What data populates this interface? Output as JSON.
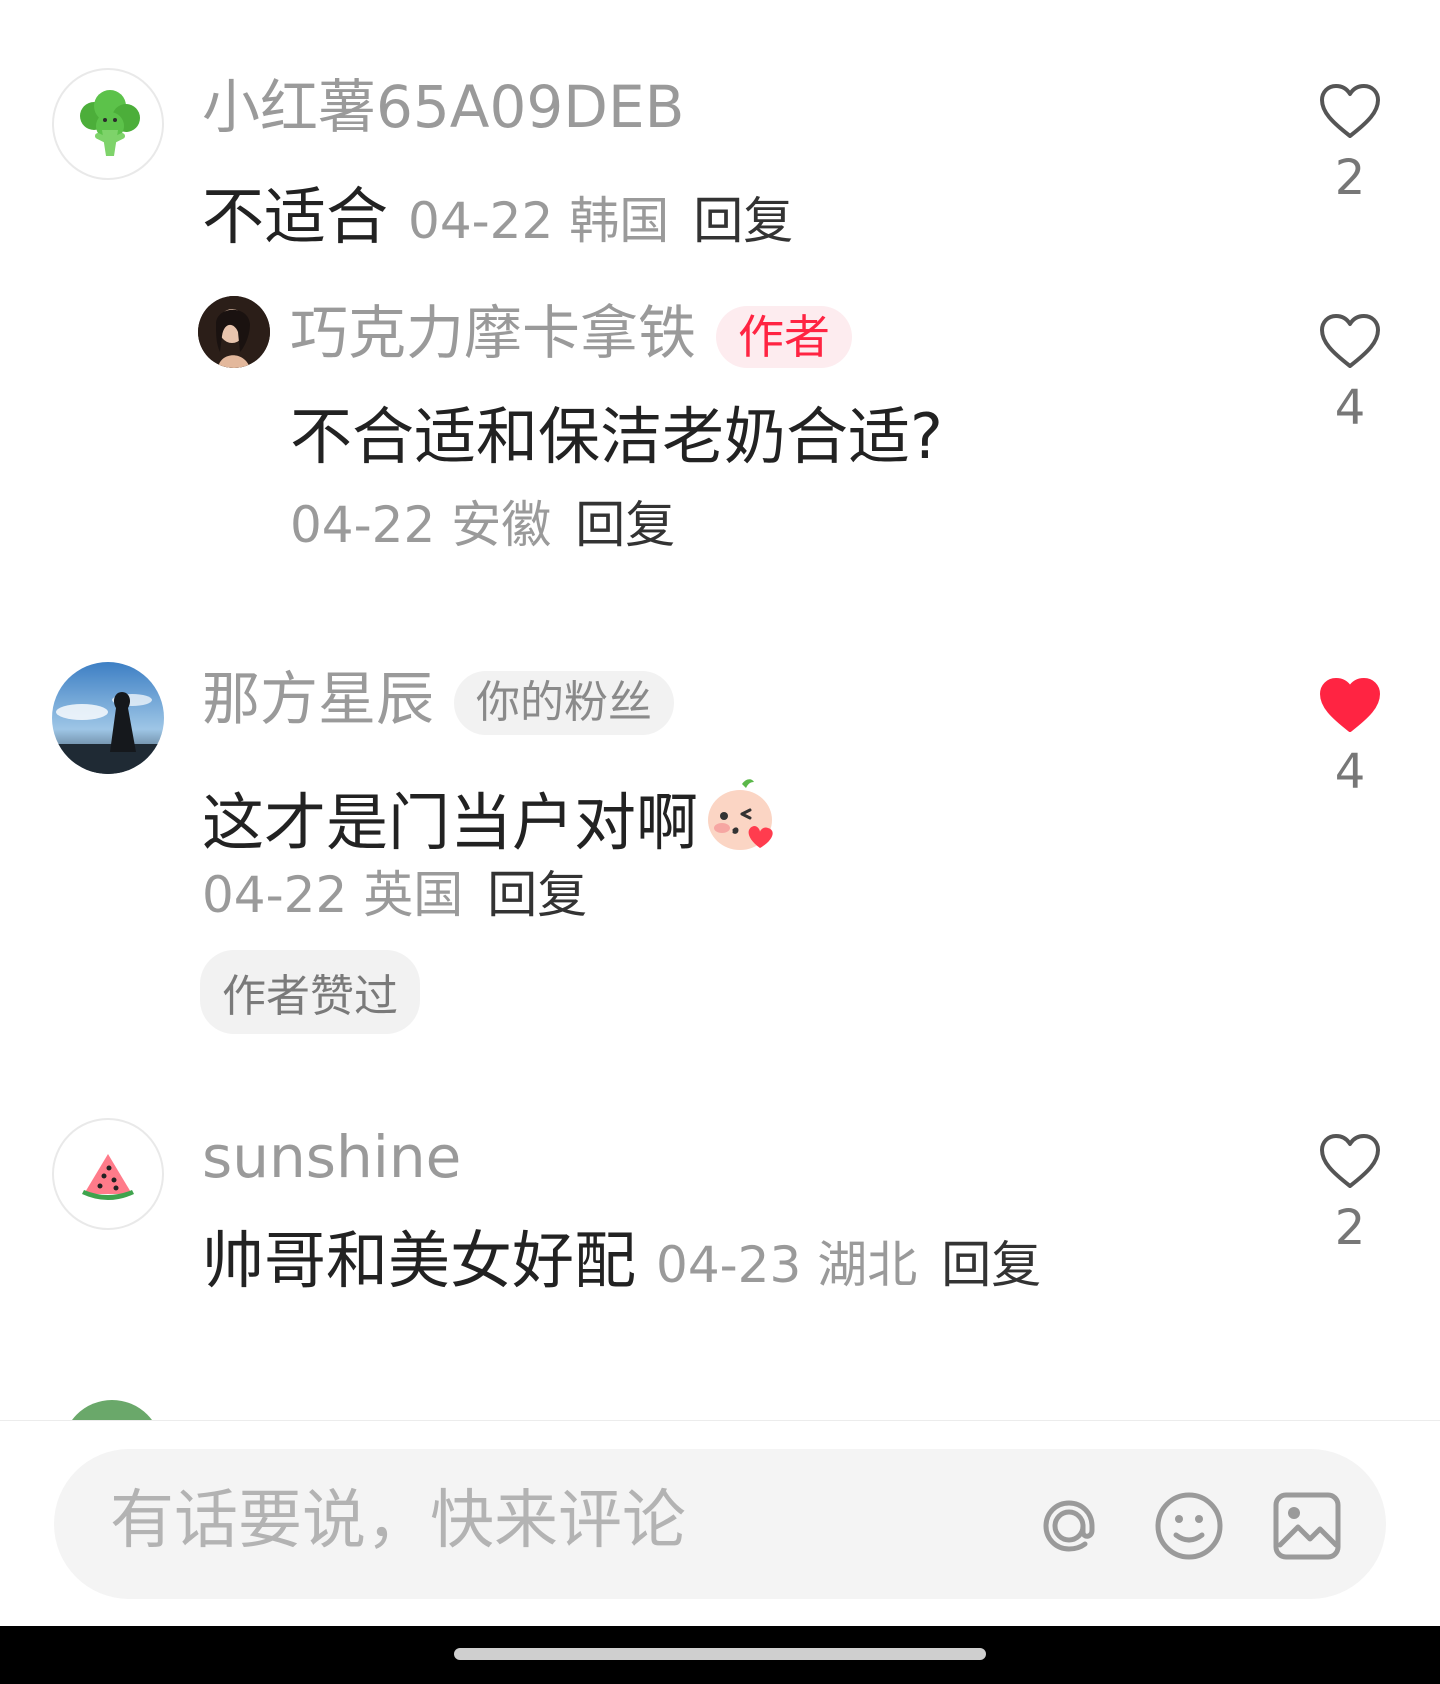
{
  "comments": [
    {
      "username": "小红薯65A09DEB",
      "content": "不适合",
      "date": "04-22",
      "location": "韩国",
      "reply": "回复",
      "likes": "2",
      "liked": false
    },
    {
      "username": "巧克力摩卡拿铁",
      "badge": "作者",
      "content": "不合适和保洁老奶合适?",
      "date": "04-22",
      "location": "安徽",
      "reply": "回复",
      "likes": "4",
      "liked": false
    },
    {
      "username": "那方星辰",
      "badge": "你的粉丝",
      "content": "这才是门当户对啊",
      "date": "04-22",
      "location": "英国",
      "reply": "回复",
      "tag": "作者赞过",
      "likes": "4",
      "liked": true
    },
    {
      "username": "sunshine",
      "content": "帅哥和美女好配",
      "date": "04-23",
      "location": "湖北",
      "reply": "回复",
      "likes": "2",
      "liked": false
    }
  ],
  "input": {
    "placeholder": "有话要说，快来评论"
  },
  "colors": {
    "accent": "#ff2442",
    "like_active": "#ff2442"
  },
  "icons": [
    "broccoli-icon",
    "heart-outline-icon",
    "heart-filled-icon",
    "watermelon-icon",
    "blush-emoji-icon",
    "at-icon",
    "smiley-icon",
    "image-icon"
  ]
}
